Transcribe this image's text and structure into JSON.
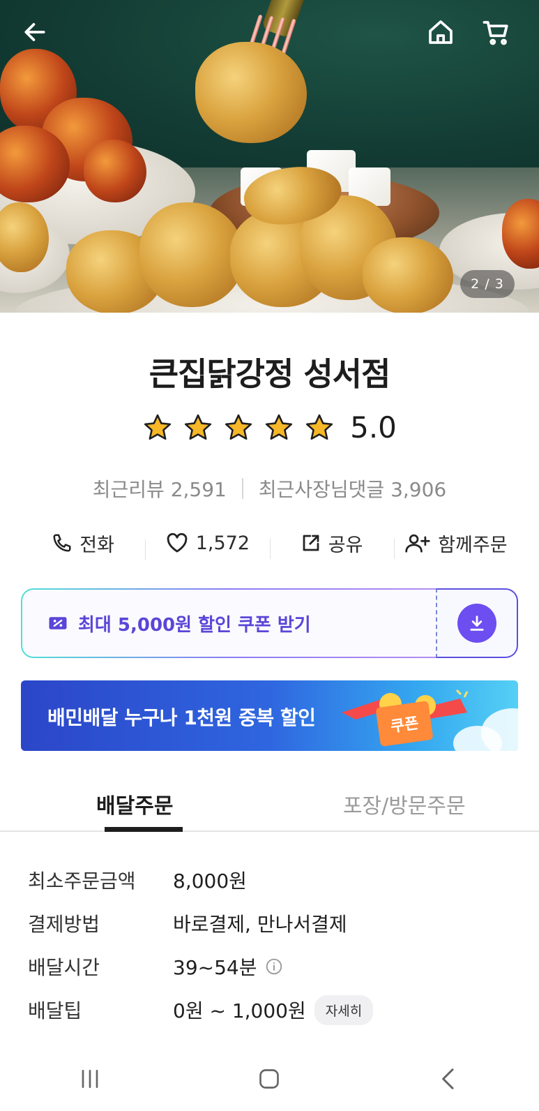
{
  "hero": {
    "page_indicator": "2 / 3",
    "icons": {
      "back": "arrow-left-icon",
      "home": "home-icon",
      "cart": "cart-icon"
    }
  },
  "store": {
    "name": "큰집닭강정 성서점",
    "rating": "5.0",
    "stars": 5,
    "recent_reviews": "최근리뷰 2,591",
    "owner_replies": "최근사장님댓글 3,906"
  },
  "actions": {
    "call": "전화",
    "likes": "1,572",
    "share": "공유",
    "group_order": "함께주문"
  },
  "coupon": {
    "label": "최대 5,000원 할인 쿠폰 받기",
    "accent": "#6d4ef0"
  },
  "banner": {
    "text": "배민배달 누구나 1천원 중복 할인",
    "ticket": "쿠폰"
  },
  "tabs": {
    "delivery": "배달주문",
    "pickup": "포장/방문주문",
    "active": "delivery"
  },
  "info": {
    "rows": [
      {
        "label": "최소주문금액",
        "value": "8,000원"
      },
      {
        "label": "결제방법",
        "value": "바로결제, 만나서결제"
      },
      {
        "label": "배달시간",
        "value": "39~54분"
      },
      {
        "label": "배달팁",
        "value": "0원 ~ 1,000원"
      }
    ],
    "detail_button": "자세히"
  },
  "colors": {
    "primary": "#6d4ef0",
    "text": "#1d1d1d",
    "muted": "#8a8a8a",
    "star": "#f6b728"
  }
}
